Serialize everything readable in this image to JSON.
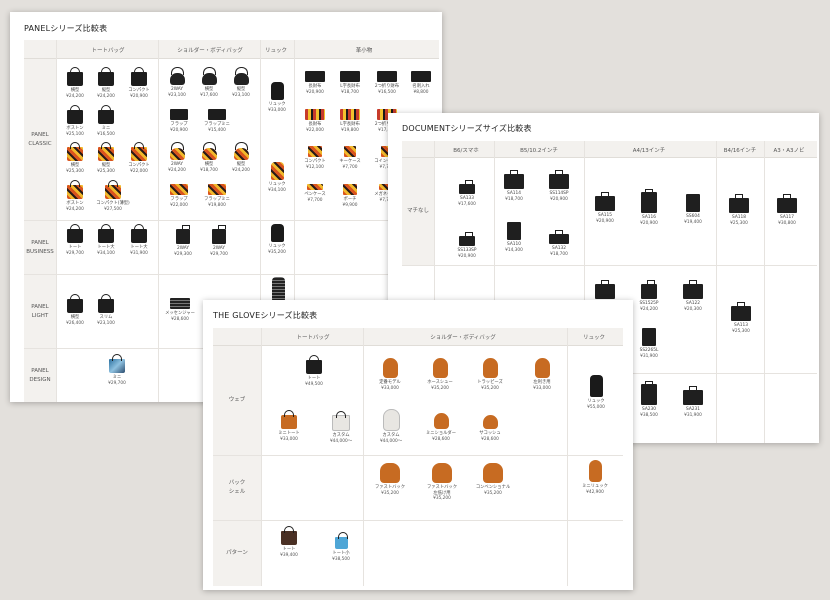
{
  "panel_sheet": {
    "title": "PANELシリーズ比較表",
    "headers": [
      "トートバッグ",
      "ショルダー・ボディバッグ",
      "リュック",
      "革小物"
    ],
    "rows": [
      "PANEL\nCLASSIC",
      "PANEL\nBUSINESS",
      "PANEL\nLIGHT",
      "PANEL\nDESIGN"
    ],
    "items": [
      {
        "name": "横型",
        "price": "¥24,200"
      },
      {
        "name": "縦型",
        "price": "¥24,200"
      },
      {
        "name": "コンパクト",
        "price": "¥20,900"
      },
      {
        "name": "2WAY",
        "price": "¥23,100"
      },
      {
        "name": "横型",
        "price": "¥17,600"
      },
      {
        "name": "縦型",
        "price": "¥23,100"
      },
      {
        "name": "リュック",
        "price": "¥33,000"
      },
      {
        "name": "長財布",
        "price": "¥20,900"
      },
      {
        "name": "L字長財布",
        "price": "¥18,700"
      },
      {
        "name": "2つ折り財布",
        "price": "¥16,500"
      },
      {
        "name": "名刺入れ",
        "price": "¥8,800"
      },
      {
        "name": "ボストン",
        "price": "¥25,100"
      },
      {
        "name": "ミニ",
        "price": "¥16,500"
      },
      {
        "name": "フラップ",
        "price": "¥20,900"
      },
      {
        "name": "フラップミニ",
        "price": "¥15,400"
      },
      {
        "name": "長財布",
        "price": "¥22,000"
      },
      {
        "name": "L字長財布",
        "price": "¥19,800"
      },
      {
        "name": "2つ折り財布",
        "price": "¥17,600"
      },
      {
        "name": "横型",
        "price": "¥25,300"
      },
      {
        "name": "縦型",
        "price": "¥25,300"
      },
      {
        "name": "コンパクト",
        "price": "¥22,000"
      },
      {
        "name": "2WAY",
        "price": "¥24,200"
      },
      {
        "name": "横型",
        "price": "¥18,700"
      },
      {
        "name": "縦型",
        "price": "¥24,200"
      },
      {
        "name": "コンパクト",
        "price": "¥12,100"
      },
      {
        "name": "キーケース",
        "price": "¥7,700"
      },
      {
        "name": "コインケース",
        "price": "¥7,700"
      },
      {
        "name": "ボストン",
        "price": "¥24,200"
      },
      {
        "name": "コンパクト(薄型)",
        "price": "¥27,500"
      },
      {
        "name": "フラップ",
        "price": "¥22,000"
      },
      {
        "name": "フラップミニ",
        "price": "¥19,800"
      },
      {
        "name": "リュック",
        "price": "¥34,100"
      },
      {
        "name": "ペンケース",
        "price": "¥7,700"
      },
      {
        "name": "ポーチ",
        "price": "¥9,900"
      },
      {
        "name": "メガネケース",
        "price": "¥7,700"
      },
      {
        "name": "トート",
        "price": "¥29,700"
      },
      {
        "name": "トート大",
        "price": "¥34,100"
      },
      {
        "name": "トート大",
        "price": "¥31,900"
      },
      {
        "name": "2WAY",
        "price": "¥29,300"
      },
      {
        "name": "2WAY",
        "price": "¥29,700"
      },
      {
        "name": "リュック",
        "price": "¥35,200"
      },
      {
        "name": "横型",
        "price": "¥26,400"
      },
      {
        "name": "スリム",
        "price": "¥23,100"
      },
      {
        "name": "メッセンジャー",
        "price": "¥28,600"
      },
      {
        "name": "ミニ",
        "price": "¥29,700"
      }
    ]
  },
  "document_sheet": {
    "title": "DOCUMENTシリーズサイズ比較表",
    "headers": [
      "B6/スマホ",
      "B5/10.2インチ",
      "A4/13インチ",
      "B4/16インチ",
      "A3・A3ノビ"
    ],
    "rows": [
      "マチなし"
    ],
    "items": [
      {
        "name": "SA133",
        "price": "¥17,600"
      },
      {
        "name": "SA114",
        "price": "¥18,700"
      },
      {
        "name": "SS114SP",
        "price": "¥20,900"
      },
      {
        "name": "SA115",
        "price": "¥20,900"
      },
      {
        "name": "SA116",
        "price": "¥20,900"
      },
      {
        "name": "SS604",
        "price": "¥19,400"
      },
      {
        "name": "SA118",
        "price": "¥25,300"
      },
      {
        "name": "SA117",
        "price": "¥30,800"
      },
      {
        "name": "SS133SP",
        "price": "¥20,900"
      },
      {
        "name": "SA110",
        "price": "¥14,300"
      },
      {
        "name": "SA132",
        "price": "¥18,700"
      },
      {
        "name": "SS1525P",
        "price": "¥24,200"
      },
      {
        "name": "SA122",
        "price": "¥20,300"
      },
      {
        "name": "SA113",
        "price": "¥25,300"
      },
      {
        "name": "SS2265L",
        "price": "¥31,900"
      },
      {
        "name": "SA230",
        "price": "¥38,500"
      },
      {
        "name": "SA231",
        "price": "¥31,900"
      }
    ]
  },
  "glove_sheet": {
    "title": "THE GLOVEシリーズ比較表",
    "headers": [
      "トートバッグ",
      "ショルダー・ボディバッグ",
      "リュック"
    ],
    "rows": [
      "ウェブ",
      "バック\nシェル",
      "パターン"
    ],
    "items": [
      {
        "name": "トート",
        "price": "¥49,500"
      },
      {
        "name": "定番モデル",
        "price": "¥33,000"
      },
      {
        "name": "ホースシュー",
        "price": "¥35,200"
      },
      {
        "name": "トラッピーズ",
        "price": "¥35,200"
      },
      {
        "name": "左利き用",
        "price": "¥33,000"
      },
      {
        "name": "リュック",
        "price": "¥55,000"
      },
      {
        "name": "ミニトート",
        "price": "¥33,000"
      },
      {
        "name": "カスタム",
        "price": "¥44,000〜"
      },
      {
        "name": "カスタム",
        "price": "¥44,000〜"
      },
      {
        "name": "ミニショルダー",
        "price": "¥28,600"
      },
      {
        "name": "サコッシュ",
        "price": "¥28,600"
      },
      {
        "name": "ファストバック",
        "price": "¥35,200"
      },
      {
        "name": "ファストバック\n左低け用",
        "price": "¥35,200"
      },
      {
        "name": "コンベンショナル",
        "price": "¥35,200"
      },
      {
        "name": "ミニリュック",
        "price": "¥42,900"
      },
      {
        "name": "トート",
        "price": "¥39,400"
      },
      {
        "name": "トート小",
        "price": "¥38,500"
      }
    ]
  }
}
